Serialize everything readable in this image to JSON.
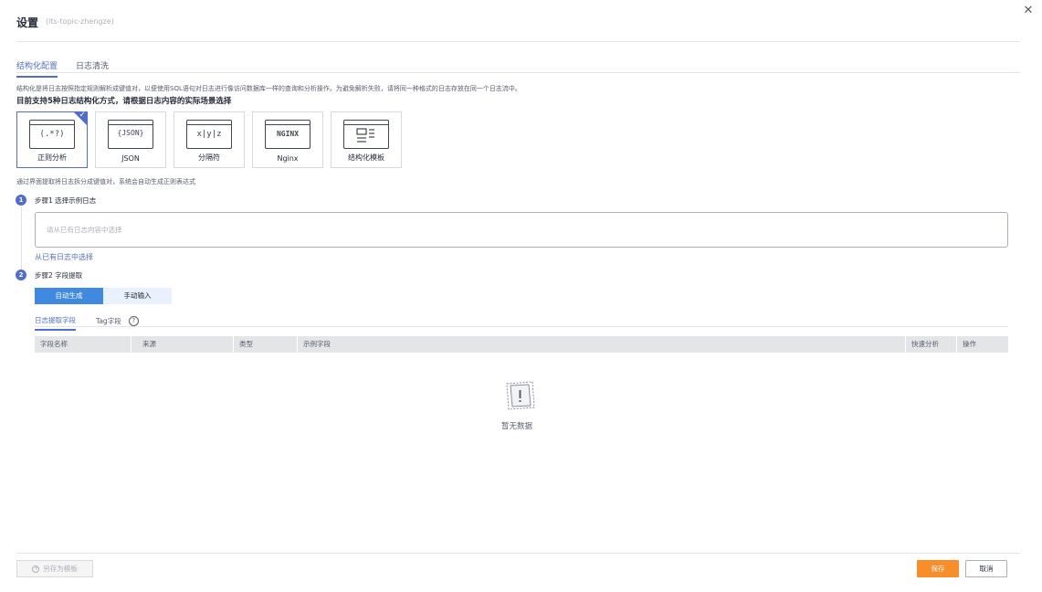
{
  "header": {
    "title": "设置",
    "subtitle": "(lts-topic-zhengze)",
    "close_icon": "close-icon"
  },
  "tabs": [
    {
      "label": "结构化配置",
      "active": true
    },
    {
      "label": "日志清洗",
      "active": false
    }
  ],
  "description": "结构化是将日志按照指定规则解析成键值对，以便使用SQL语句对日志进行像访问数据库一样的查询和分析操作。为避免解析失败，请将同一种格式的日志存放在同一个日志流中。",
  "support_text": "目前支持5种日志结构化方式，请根据日志内容的实际场景选择",
  "cards": [
    {
      "label": "正则分析",
      "glyph": "(.*?)",
      "icon": "regex-icon",
      "selected": true
    },
    {
      "label": "JSON",
      "glyph": "{JSON}",
      "icon": "json-icon",
      "selected": false
    },
    {
      "label": "分隔符",
      "glyph": "x|y|z",
      "icon": "delimiter-icon",
      "selected": false
    },
    {
      "label": "Nginx",
      "glyph": "NGINX",
      "icon": "nginx-icon",
      "selected": false
    },
    {
      "label": "结构化模板",
      "glyph": "",
      "icon": "template-icon",
      "selected": false
    }
  ],
  "hint": "通过界面提取将日志拆分成键值对，系统会自动生成正则表达式",
  "step1": {
    "number": "1",
    "label": "步骤1 选择示例日志",
    "placeholder": "请从已有日志内容中选择",
    "link": "从已有日志中选择"
  },
  "step2": {
    "number": "2",
    "label": "步骤2 字段提取",
    "modes": [
      {
        "label": "自动生成",
        "active": true
      },
      {
        "label": "手动输入",
        "active": false
      }
    ]
  },
  "subtabs": [
    {
      "label": "日志提取字段",
      "active": true
    },
    {
      "label": "Tag字段",
      "active": false
    }
  ],
  "help_icon": "?",
  "table": {
    "columns": [
      "字段名称",
      "来源",
      "类型",
      "示例字段",
      "快速分析",
      "操作"
    ],
    "empty_text": "暂无数据"
  },
  "footer": {
    "template_button": "另存为模板",
    "save_button": "保存",
    "cancel_button": "取消"
  },
  "colors": {
    "primary": "#526ecc",
    "accent_orange": "#f88e2a",
    "segment_active": "#3f8ae0"
  }
}
